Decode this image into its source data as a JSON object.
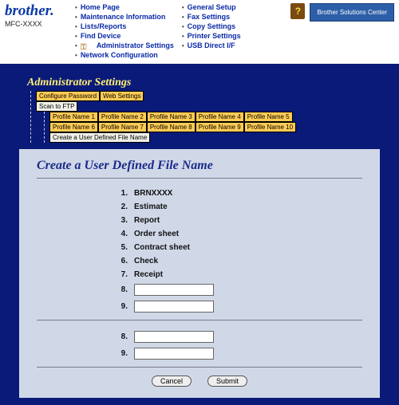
{
  "brand": {
    "logo": "brother.",
    "model": "MFC-XXXX"
  },
  "nav": {
    "col1": [
      "Home Page",
      "Maintenance Information",
      "Lists/Reports",
      "Find Device",
      "Administrator Settings",
      "Network Configuration"
    ],
    "col2": [
      "General Setup",
      "Fax Settings",
      "Copy Settings",
      "Printer Settings",
      "USB Direct I/F"
    ]
  },
  "solutions_center": "Brother Solutions Center",
  "page_title": "Administrator Settings",
  "tabs": {
    "row1": [
      "Configure Password",
      "Web Settings"
    ],
    "row2_plain": "Scan to FTP",
    "profiles": [
      "Profile Name 1",
      "Profile Name 2",
      "Profile Name 3",
      "Profile Name 4",
      "Profile Name 5",
      "Profile Name 6",
      "Profile Name 7",
      "Profile Name 8",
      "Profile Name 9",
      "Profile Name 10"
    ],
    "user_defined": "Create a User Defined File Name"
  },
  "card": {
    "title": "Create a User Defined File Name",
    "names": [
      "BRNXXXX",
      "Estimate",
      "Report",
      "Order sheet",
      "Contract sheet",
      "Check",
      "Receipt"
    ],
    "inputs_a": [
      "8.",
      "9."
    ],
    "inputs_b": [
      "8.",
      "9."
    ],
    "cancel": "Cancel",
    "submit": "Submit"
  }
}
